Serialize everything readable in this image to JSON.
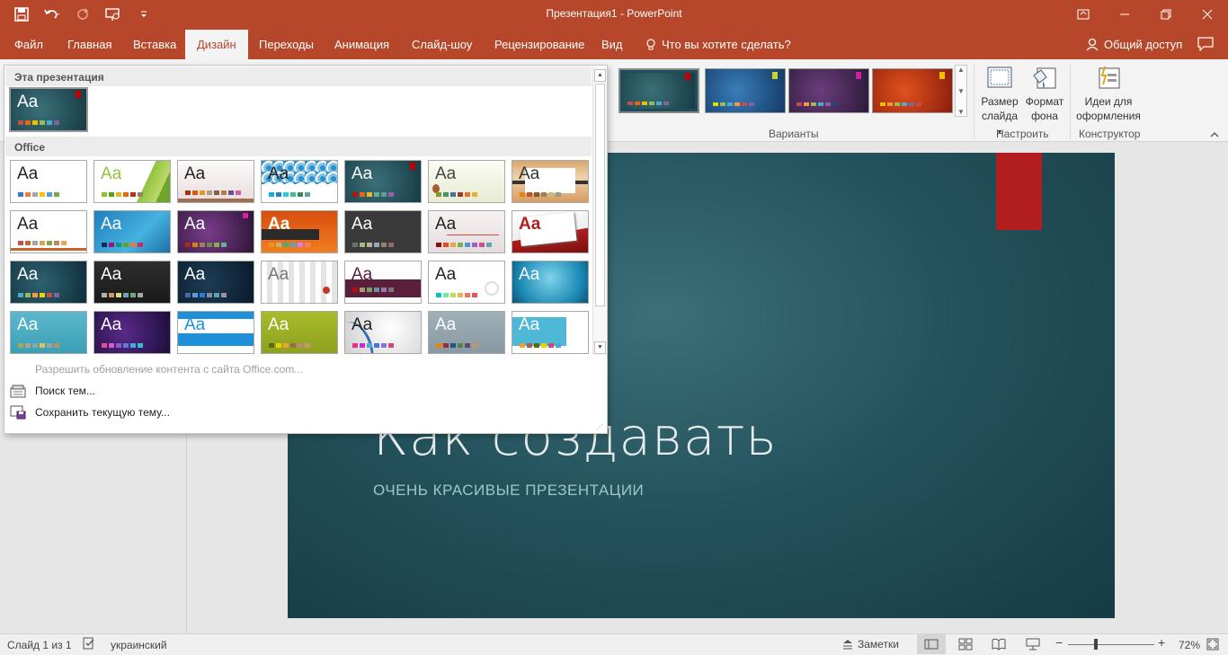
{
  "window": {
    "title": "Презентация1 - PowerPoint"
  },
  "tabs": {
    "file": "Файл",
    "home": "Главная",
    "insert": "Вставка",
    "design": "Дизайн",
    "transitions": "Переходы",
    "animations": "Анимация",
    "slideshow": "Слайд-шоу",
    "review": "Рецензирование",
    "view": "Вид",
    "tell_me": "Что вы хотите сделать?",
    "share": "Общий доступ"
  },
  "ribbon": {
    "variants_label": "Варианты",
    "customize_label": "Настроить",
    "designer_label": "Конструктор",
    "slide_size": "Размер слайда",
    "slide_size_line1": "Размер",
    "slide_size_line2": "слайда",
    "format_bg_line1": "Формат",
    "format_bg_line2": "фона",
    "design_ideas_line1": "Идеи для",
    "design_ideas_line2": "оформления"
  },
  "gallery": {
    "this_presentation": "Эта презентация",
    "office": "Office",
    "enable_updates": "Разрешить обновление контента с сайта Office.com...",
    "browse_themes": "Поиск тем...",
    "save_theme": "Сохранить текущую тему...",
    "aa": "Aa"
  },
  "slide": {
    "title": "Как создавать",
    "subtitle": "ОЧЕНЬ КРАСИВЫЕ ПРЕЗЕНТАЦИИ"
  },
  "status": {
    "slide_count": "Слайд 1 из 1",
    "language": "украинский",
    "notes": "Заметки",
    "zoom": "72%"
  },
  "colors": {
    "accent": "#b7472a",
    "slide_bg": "#24535d",
    "slide_tag": "#b21e1e"
  }
}
